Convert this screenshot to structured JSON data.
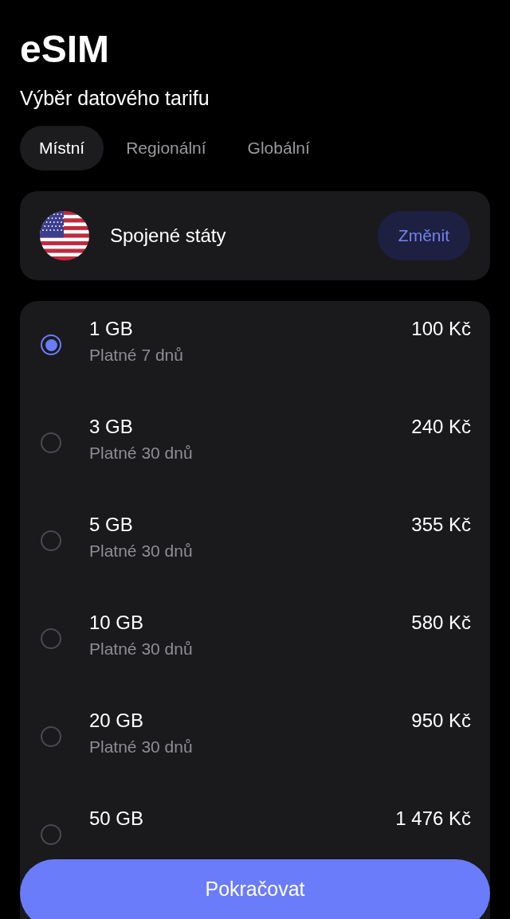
{
  "title": "eSIM",
  "subtitle": "Výběr datového tarifu",
  "tabs": [
    {
      "label": "Místní",
      "selected": true
    },
    {
      "label": "Regionální",
      "selected": false
    },
    {
      "label": "Globální",
      "selected": false
    }
  ],
  "country": {
    "name": "Spojené státy",
    "change_button": "Změnit"
  },
  "plans": [
    {
      "data": "1 GB",
      "validity": "Platné 7 dnů",
      "price": "100 Kč",
      "selected": true
    },
    {
      "data": "3 GB",
      "validity": "Platné 30 dnů",
      "price": "240 Kč",
      "selected": false
    },
    {
      "data": "5 GB",
      "validity": "Platné 30 dnů",
      "price": "355 Kč",
      "selected": false
    },
    {
      "data": "10 GB",
      "validity": "Platné 30 dnů",
      "price": "580 Kč",
      "selected": false
    },
    {
      "data": "20 GB",
      "validity": "Platné 30 dnů",
      "price": "950 Kč",
      "selected": false
    },
    {
      "data": "50 GB",
      "price": "1 476 Kč",
      "selected": false
    }
  ],
  "continue_button": "Pokračovat"
}
